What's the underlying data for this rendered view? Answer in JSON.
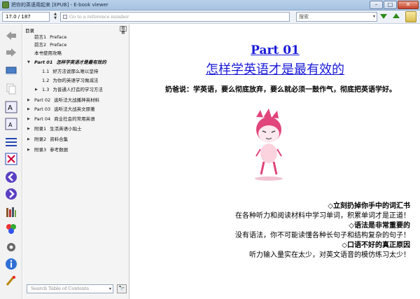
{
  "window": {
    "title": "把你的英语用起来 [EPUB] - E-book viewer",
    "min_label": "–",
    "max_label": "□",
    "close_label": "✕"
  },
  "toolbar": {
    "page_value": "17.0 / 187",
    "reference_placeholder": "Go to a reference number",
    "search_placeholder": "搜索",
    "search_drop": "▾",
    "spin_up": "▲",
    "spin_down": "▼"
  },
  "left_tools": [
    {
      "name": "back-icon"
    },
    {
      "name": "forward-icon"
    },
    {
      "name": "library-icon"
    },
    {
      "name": "copy-icon"
    },
    {
      "name": "font-larger-icon"
    },
    {
      "name": "font-smaller-icon"
    },
    {
      "name": "toc-icon"
    },
    {
      "name": "fullscreen-icon"
    },
    {
      "name": "previous-page-icon"
    },
    {
      "name": "next-page-icon"
    },
    {
      "name": "bookmark-icon"
    },
    {
      "name": "theme-icon"
    },
    {
      "name": "preferences-icon"
    },
    {
      "name": "info-icon"
    },
    {
      "name": "print-icon"
    }
  ],
  "toc": {
    "header": "目录",
    "close_label": "隐藏",
    "items": [
      {
        "num": "前言1",
        "label": "Preface"
      },
      {
        "num": "前言2",
        "label": "Preface"
      },
      {
        "num": "",
        "label": "本书使用攻略"
      },
      {
        "num": "Part 01",
        "label": "怎样学英语才是最有效的"
      },
      {
        "num": "1.1",
        "label": "好方法说那么难以坚持"
      },
      {
        "num": "1.2",
        "label": "为你的英语学习做减法"
      },
      {
        "num": "1.3",
        "label": "为普通人打造的学习方法"
      },
      {
        "num": "Part 02",
        "label": "选听法大战播神英材料"
      },
      {
        "num": "Part 03",
        "label": "选听法大战英文原著"
      },
      {
        "num": "Part 04",
        "label": "商业社会的常用英语"
      },
      {
        "num": "附录1",
        "label": "生活英语小贴士"
      },
      {
        "num": "附录2",
        "label": "资料合集"
      },
      {
        "num": "附录3",
        "label": "参考数据"
      }
    ],
    "search_placeholder": "Search Table of Contents",
    "search_drop": "▾",
    "go_label": "🔭"
  },
  "content": {
    "part_label": "Part 01",
    "chapter_title": "怎样学英语才是最有效的",
    "intro": "奶爸说：学英语，要么彻底放弃，要么就必须一鼓作气，彻底把英语学好。",
    "points": [
      {
        "text": "◇立刻扔掉你手中的词汇书",
        "bold": true
      },
      {
        "text": "在各种听力和阅读材料中学习单词，积累单词才是正道！",
        "bold": false
      },
      {
        "text": "◇语法是非常重要的",
        "bold": true
      },
      {
        "text": "没有语法，你不可能读懂各种长句子和结构复杂的句子！",
        "bold": false
      },
      {
        "text": "◇口语不好的真正原因",
        "bold": true
      },
      {
        "text": "听力输入量实在太少，对英文语音的模仿练习太少！",
        "bold": false
      }
    ]
  },
  "colors": {
    "title_blue": "#1a1ad8",
    "accent_green": "#2f8a1d",
    "figure_pink": "#e0457b"
  }
}
